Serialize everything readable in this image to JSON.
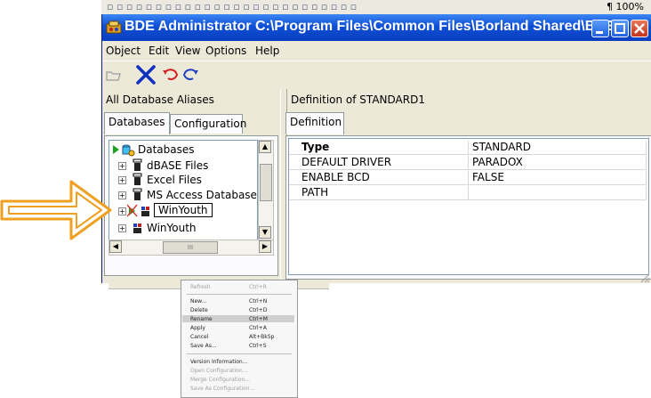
{
  "toolbar_strip": {
    "zoom": "100%",
    "pilcrow": "¶"
  },
  "window": {
    "title": "BDE Administrator  C:\\Program Files\\Common Files\\Borland Shared\\BDE...",
    "menu": [
      "Object",
      "Edit",
      "View",
      "Options",
      "Help"
    ]
  },
  "left_pane": {
    "header": "All Database Aliases",
    "tabs": [
      "Databases",
      "Configuration"
    ],
    "tree": [
      {
        "label": "Databases",
        "exp": ""
      },
      {
        "label": "dBASE Files",
        "exp": "+"
      },
      {
        "label": "Excel Files",
        "exp": "+"
      },
      {
        "label": "MS Access Database",
        "exp": "+"
      },
      {
        "label": "WinYouth",
        "exp": "+"
      },
      {
        "label": "WinYouth",
        "exp": "+"
      }
    ],
    "scroll_glyph": "III"
  },
  "right_pane": {
    "header": "Definition of STANDARD1",
    "tab": "Definition",
    "rows": [
      {
        "key": "Type",
        "value": "STANDARD"
      },
      {
        "key": "DEFAULT DRIVER",
        "value": "PARADOX"
      },
      {
        "key": "ENABLE BCD",
        "value": "FALSE"
      },
      {
        "key": "PATH",
        "value": ""
      }
    ]
  },
  "context_menu": {
    "items": [
      {
        "label": "Refresh",
        "shortcut": "Ctrl+R"
      },
      {
        "label": "New...",
        "shortcut": "Ctrl+N"
      },
      {
        "label": "Delete",
        "shortcut": "Ctrl+D"
      },
      {
        "label": "Rename",
        "shortcut": "Ctrl+M"
      },
      {
        "label": "Apply",
        "shortcut": "Ctrl+A"
      },
      {
        "label": "Cancel",
        "shortcut": "Alt+BkSp"
      },
      {
        "label": "Save As...",
        "shortcut": "Ctrl+S"
      },
      {
        "label": "Version Information...",
        "shortcut": ""
      },
      {
        "label": "Open Configuration...",
        "shortcut": ""
      },
      {
        "label": "Merge Configuration...",
        "shortcut": ""
      },
      {
        "label": "Save As Configuration...",
        "shortcut": ""
      }
    ]
  },
  "colors": {
    "title_blue": "#0f4fd6",
    "arrow_orange": "#f0a020",
    "close_red": "#c1351b"
  }
}
